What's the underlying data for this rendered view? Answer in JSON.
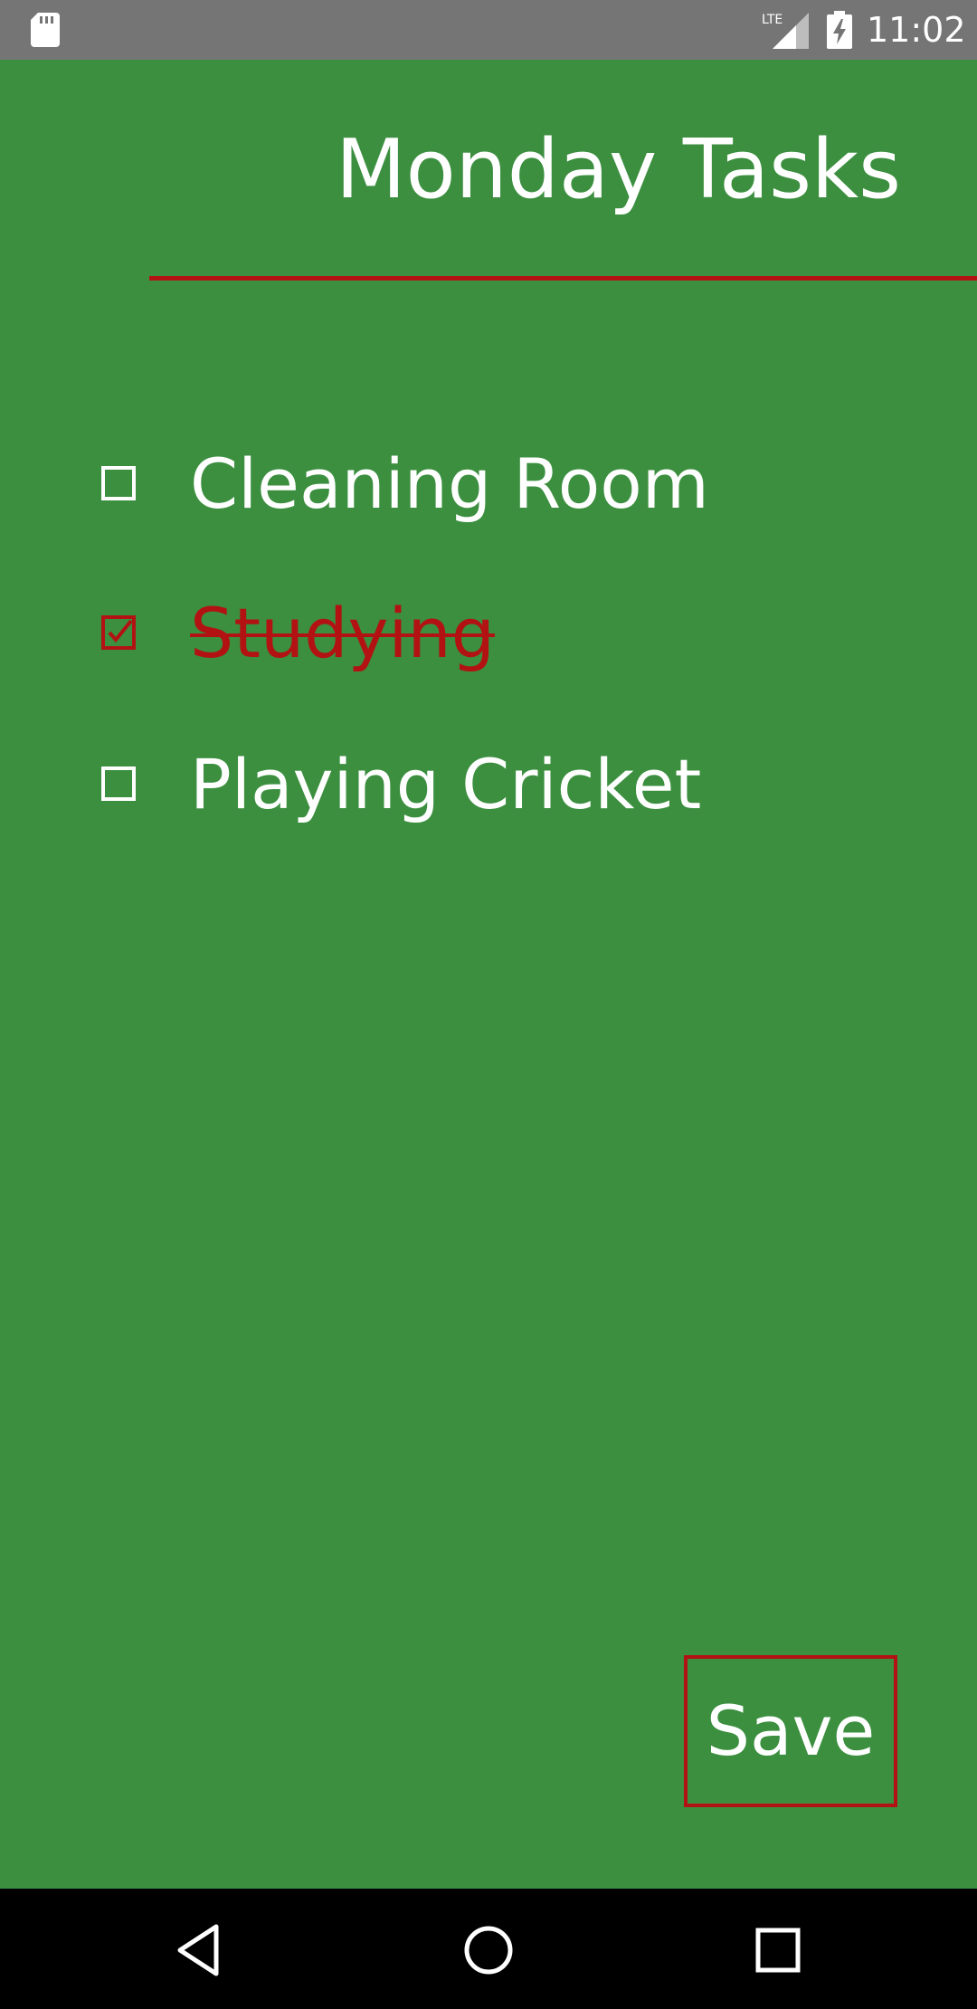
{
  "status_bar": {
    "time": "11:02",
    "network_label": "LTE",
    "icons": [
      "sd-card-icon",
      "lte-signal-icon",
      "battery-charging-icon"
    ]
  },
  "title": "Monday Tasks",
  "tasks": [
    {
      "label": "Cleaning Room",
      "checked": false
    },
    {
      "label": "Studying",
      "checked": true
    },
    {
      "label": "Playing Cricket",
      "checked": false
    }
  ],
  "save_label": "Save",
  "nav": {
    "icons": [
      "back-icon",
      "home-icon",
      "recents-icon"
    ]
  },
  "colors": {
    "background": "#3b8f3f",
    "accent": "#b31212",
    "status_bar": "#757575",
    "nav_bar": "#000000",
    "text": "#ffffff"
  }
}
